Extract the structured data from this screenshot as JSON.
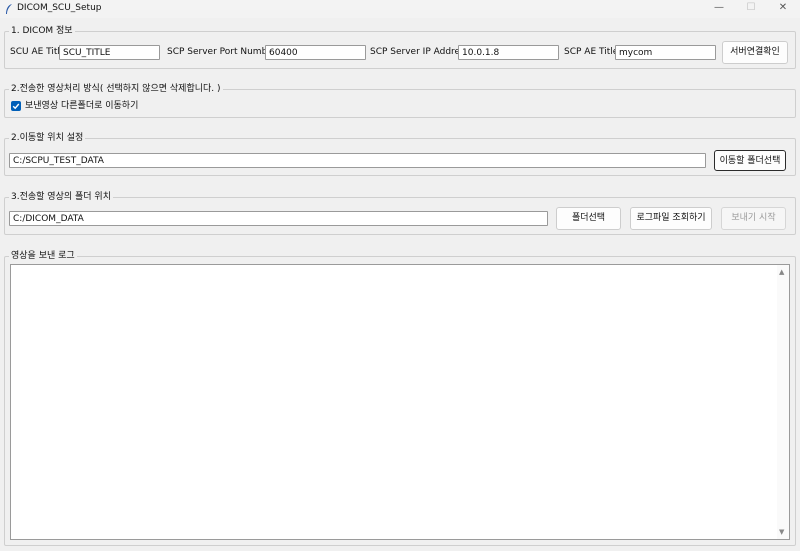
{
  "window": {
    "title": "DICOM_SCU_Setup",
    "minimize_glyph": "—",
    "maximize_glyph": "☐",
    "close_glyph": "✕"
  },
  "dicom_info": {
    "legend": "1. DICOM 정보",
    "scu_ae_title_label": "SCU AE Title",
    "scu_ae_title_value": "SCU_TITLE",
    "scp_port_label": "SCP Server Port Number",
    "scp_port_value": "60400",
    "scp_ip_label": "SCP Server IP Address",
    "scp_ip_value": "10.0.1.8",
    "scp_ae_title_label": "SCP AE Title",
    "scp_ae_title_value": "mycom",
    "connect_button": "서버연결확인"
  },
  "processing": {
    "legend": "2.전송한 영상처리 방식( 선택하지 않으면 삭제합니다. )",
    "move_checkbox_label": "보낸영상 다른폴더로 이동하기",
    "move_checked": true
  },
  "move_location": {
    "legend": "2.이동할 위치 설정",
    "path_value": "C:/SCPU_TEST_DATA",
    "select_button": "이동할 폴더선택"
  },
  "source_folder": {
    "legend": "3.전송할 영상의 폴더 위치",
    "path_value": "C:/DICOM_DATA",
    "folder_button": "폴더선택",
    "log_button": "로그파일 조회하기",
    "send_button": "보내기 시작"
  },
  "log": {
    "legend": "영상을 보낸 로그",
    "content": ""
  },
  "icons": {
    "app": "feather-icon",
    "check": "checkmark-icon",
    "scroll_up": "▲",
    "scroll_down": "▼"
  }
}
